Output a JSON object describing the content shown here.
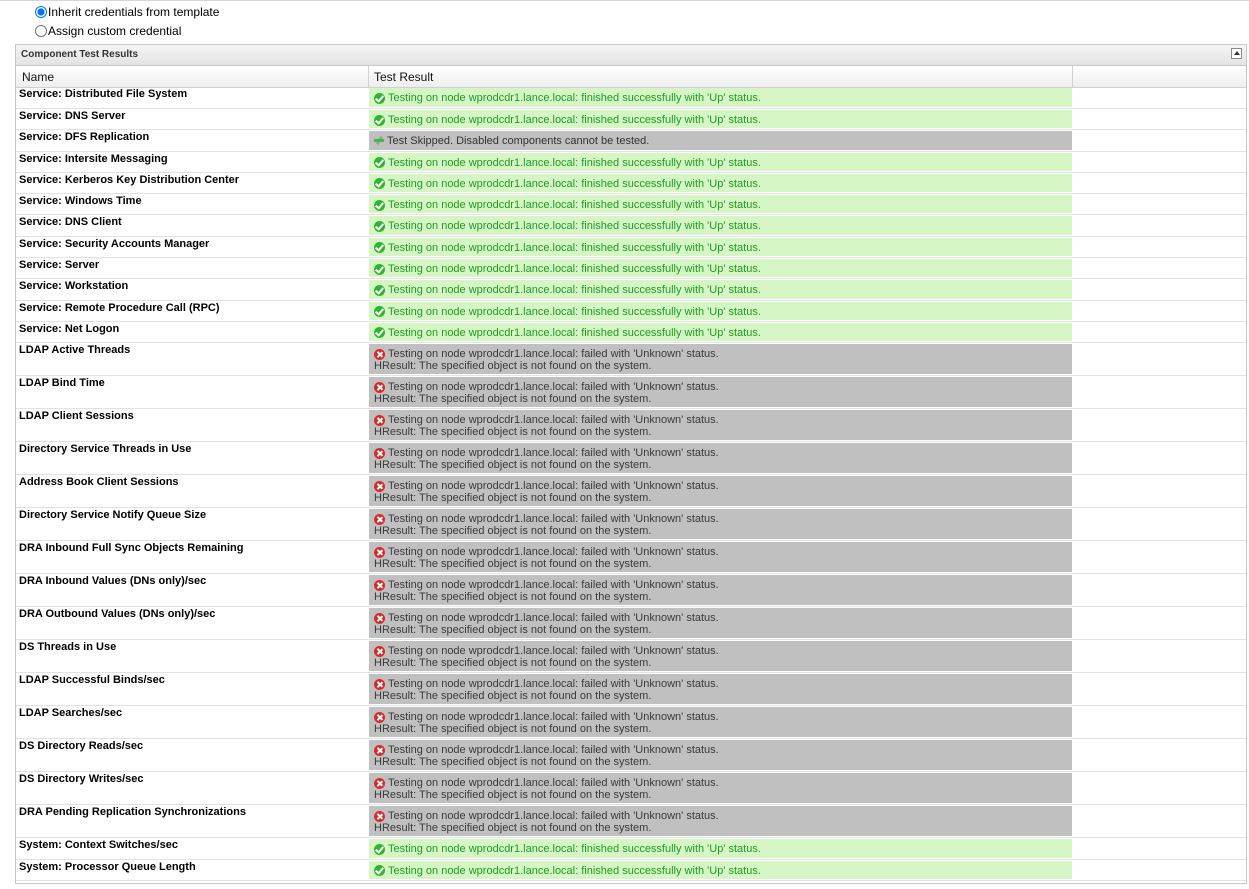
{
  "credentials": {
    "inherit_label": "Inherit credentials from template",
    "custom_label": "Assign custom credential"
  },
  "panel": {
    "title": "Component Test Results",
    "columns": {
      "name": "Name",
      "result": "Test Result"
    }
  },
  "ok_text": "Testing on node wprodcdr1.lance.local: finished successfully with 'Up' status.",
  "fail_text": "Testing on node wprodcdr1.lance.local: failed with 'Unknown' status.",
  "fail_detail": "HResult: The specified object is not found on the system.",
  "skip_text": "Test Skipped.  Disabled components cannot be tested.",
  "colors": {
    "up_bg": "#d6f5c4",
    "up_text": "#1d9e22",
    "fail_bg": "#c0c0c0"
  },
  "rows": [
    {
      "name": "Service: Distributed File System",
      "status": "up"
    },
    {
      "name": "Service: DNS Server",
      "status": "up"
    },
    {
      "name": "Service: DFS Replication",
      "status": "skip"
    },
    {
      "name": "Service: Intersite Messaging",
      "status": "up"
    },
    {
      "name": "Service: Kerberos Key Distribution Center",
      "status": "up"
    },
    {
      "name": "Service: Windows Time",
      "status": "up"
    },
    {
      "name": "Service: DNS Client",
      "status": "up"
    },
    {
      "name": "Service: Security Accounts Manager",
      "status": "up"
    },
    {
      "name": "Service: Server",
      "status": "up"
    },
    {
      "name": "Service: Workstation",
      "status": "up"
    },
    {
      "name": "Service: Remote Procedure Call (RPC)",
      "status": "up"
    },
    {
      "name": "Service: Net Logon",
      "status": "up"
    },
    {
      "name": "LDAP Active Threads",
      "status": "fail"
    },
    {
      "name": "LDAP Bind Time",
      "status": "fail"
    },
    {
      "name": "LDAP Client Sessions",
      "status": "fail"
    },
    {
      "name": "Directory Service Threads in Use",
      "status": "fail"
    },
    {
      "name": "Address Book Client Sessions",
      "status": "fail"
    },
    {
      "name": "Directory Service Notify Queue Size",
      "status": "fail"
    },
    {
      "name": "DRA Inbound Full Sync Objects Remaining",
      "status": "fail"
    },
    {
      "name": "DRA Inbound Values (DNs only)/sec",
      "status": "fail"
    },
    {
      "name": "DRA Outbound Values (DNs only)/sec",
      "status": "fail"
    },
    {
      "name": "DS Threads in Use",
      "status": "fail"
    },
    {
      "name": "LDAP Successful Binds/sec",
      "status": "fail"
    },
    {
      "name": "LDAP Searches/sec",
      "status": "fail"
    },
    {
      "name": "DS Directory Reads/sec",
      "status": "fail"
    },
    {
      "name": "DS Directory Writes/sec",
      "status": "fail"
    },
    {
      "name": "DRA Pending Replication Synchronizations",
      "status": "fail"
    },
    {
      "name": "System: Context Switches/sec",
      "status": "up"
    },
    {
      "name": "System: Processor Queue Length",
      "status": "up"
    }
  ]
}
